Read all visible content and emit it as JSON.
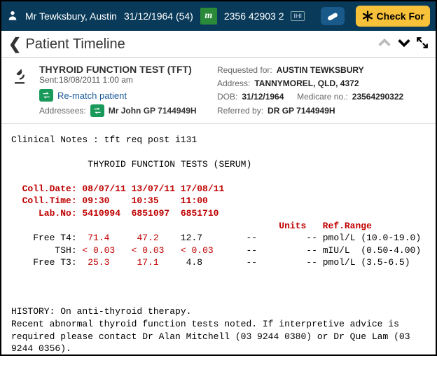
{
  "topbar": {
    "patient_name": "Mr Tewksbury, Austin",
    "dob": "31/12/1964 (54)",
    "m_label": "m",
    "ihi_label": "IHI",
    "medicare_num": "2356 42903 2",
    "check_label": "Check For"
  },
  "subheader": {
    "back": "‹",
    "title": "Patient Timeline"
  },
  "record": {
    "title": "THYROID FUNCTION TEST (TFT)",
    "sent": "Sent:18/08/2011 1:00 am",
    "rematch": "Re-match patient",
    "addressees_label": "Addressees:",
    "addressee": "Mr John GP 7144949H",
    "req_lbl": "Requested for:",
    "req_val": "AUSTIN TEWKSBURY",
    "addr_lbl": "Address:",
    "addr_val": "TANNYMOREL, QLD, 4372",
    "dob_lbl": "DOB:",
    "dob_val": "31/12/1964",
    "mc_lbl": "Medicare no.:",
    "mc_val": "2356429032­2",
    "ref_lbl": "Referred by:",
    "ref_val": "DR GP 7144949H"
  },
  "report": {
    "clinical": "Clinical Notes : tft req post i131",
    "title": "THYROID FUNCTION TESTS (SERUM)",
    "coll_date": "  Coll.Date: 08/07/11 13/07/11 17/08/11",
    "coll_time": "  Coll.Time: 09:30    10:35    11:00",
    "lab_no": "     Lab.No: 5410994  6851097  6851710",
    "hdr": "                                                 Units   Ref.Range",
    "ft4_l": "    Free T4:  ",
    "ft4_v1": "71.4",
    "ft4_v2": "47.2",
    "ft4_rest": "    12.7        --         -- pmol/L (10.0-19.0)",
    "tsh_l": "        TSH: ",
    "tsh_v1": "< 0.03",
    "tsh_v2": "< 0.03",
    "tsh_v3": "< 0.03",
    "tsh_rest": "      --         -- mIU/L  (0.50-4.00)",
    "ft3_l": "    Free T3:  ",
    "ft3_v1": "25.3",
    "ft3_v2": "17.1",
    "ft3_rest": "     4.8        --         -- pmol/L (3.5-6.5)",
    "history": "HISTORY: On anti-thyroid therapy.\nRecent abnormal thyroid function tests noted. If interpretive advice is\nrequired please contact Dr Alan Mitchell (03 9244 0380) or Dr Que Lam (03\n9244 0356)."
  }
}
